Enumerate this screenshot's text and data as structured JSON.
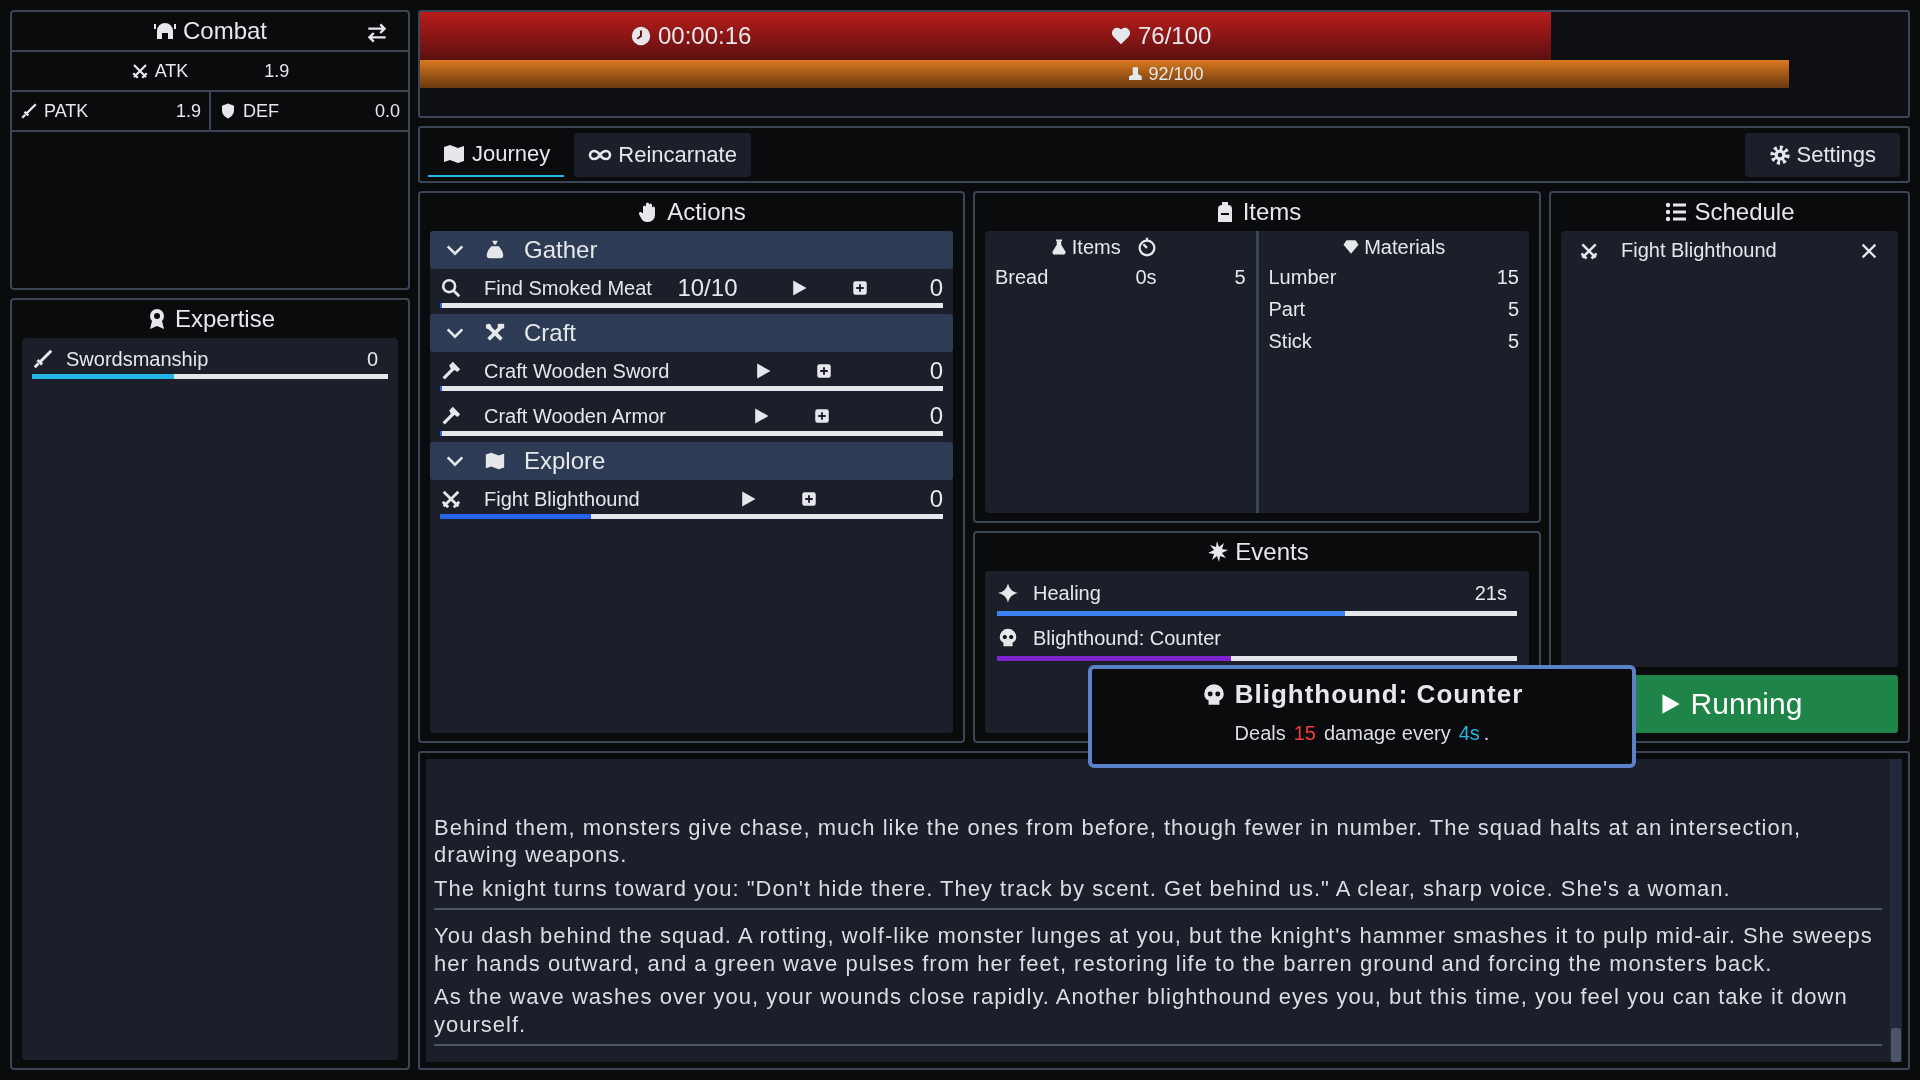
{
  "combat": {
    "title": "Combat",
    "stats": [
      {
        "kind": "atk",
        "label": "ATK",
        "value": "1.9"
      },
      {
        "kind": "patk",
        "label": "PATK",
        "value": "1.9"
      },
      {
        "kind": "def",
        "label": "DEF",
        "value": "0.0"
      }
    ]
  },
  "expertise": {
    "title": "Expertise",
    "skills": [
      {
        "kind": "sword",
        "name": "Swordsmanship",
        "value": "0",
        "level": 0.4
      }
    ]
  },
  "status": {
    "time": "00:00:16",
    "health": {
      "text": "76/100",
      "level": 0.76
    },
    "stamina": {
      "text": "92/100",
      "level": 0.92
    }
  },
  "tabs": [
    {
      "kind": "map",
      "label": "Journey",
      "selected": true
    },
    {
      "kind": "infinity",
      "label": "Reincarnate",
      "selected": false
    }
  ],
  "settings": "Settings",
  "actions": {
    "title": "Actions",
    "groups": [
      {
        "kind": "gather",
        "name": "Gather",
        "expanded": true,
        "items": [
          {
            "kind": "search",
            "name": "Find Smoked Meat",
            "count": "10/10",
            "value": "0",
            "level": 0
          }
        ]
      },
      {
        "kind": "craft",
        "name": "Craft",
        "expanded": true,
        "items": [
          {
            "kind": "craft",
            "name": "Craft Wooden Sword",
            "value": "0",
            "level": 0
          },
          {
            "kind": "craft",
            "name": "Craft Wooden Armor",
            "value": "0",
            "level": 0
          }
        ]
      },
      {
        "kind": "explore",
        "name": "Explore",
        "expanded": true,
        "items": [
          {
            "kind": "fight",
            "name": "Fight Blighthound",
            "value": "0",
            "level": 0.3
          }
        ]
      }
    ]
  },
  "items": {
    "title": "Items",
    "consumables": {
      "title": "Items",
      "rows": [
        {
          "name": "Bread",
          "time": "0s",
          "count": "5"
        }
      ]
    },
    "materials": {
      "title": "Materials",
      "rows": [
        {
          "name": "Lumber",
          "count": "15"
        },
        {
          "name": "Part",
          "count": "5"
        },
        {
          "name": "Stick",
          "count": "5"
        }
      ]
    }
  },
  "events": {
    "title": "Events",
    "list": [
      {
        "kind": "buff",
        "name": "Healing",
        "time": "21s",
        "level": 0.67,
        "color": "#3b82f6"
      },
      {
        "kind": "enemy",
        "name": "Blighthound: Counter",
        "level": 0.45,
        "color": "#7e22ce"
      }
    ]
  },
  "schedule": {
    "title": "Schedule",
    "entries": [
      {
        "kind": "fight",
        "name": "Fight Blighthound"
      }
    ],
    "run_button": "Running"
  },
  "tooltip": {
    "title": "Blighthound: Counter",
    "prefix": "Deals",
    "damage": "15",
    "middle": "damage every",
    "interval": "4s",
    "suffix": "."
  },
  "log": {
    "sections": [
      {
        "paragraphs": [
          "Behind them, monsters give chase, much like the ones from before, though fewer in number. The squad halts at an intersection, drawing weapons.",
          "The knight turns toward you: \"Don't hide there. They track by scent. Get behind us.\" A clear, sharp voice. She's a woman."
        ]
      },
      {
        "paragraphs": [
          "You dash behind the squad. A rotting, wolf-like monster lunges at you, but the knight's hammer smashes it to pulp mid-air. She sweeps her hands outward, and a green wave pulses from her feet, restoring life to the barren ground and forcing the monsters back.",
          "As the wave washes over you, your wounds close rapidly. Another blighthound eyes you, but this time, you feel you can take it down yourself."
        ]
      }
    ]
  }
}
